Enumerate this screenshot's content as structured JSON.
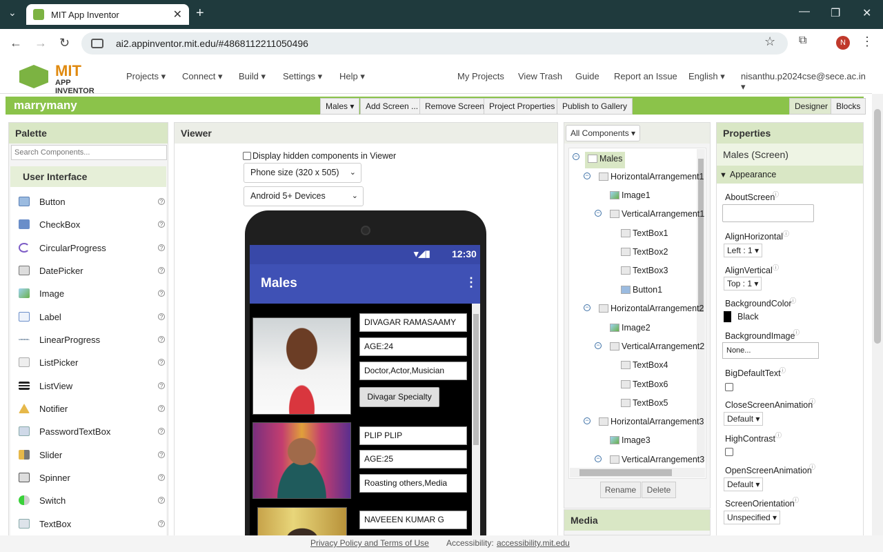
{
  "browser": {
    "tab_title": "MIT App Inventor",
    "url": "ai2.appinventor.mit.edu/#4868112211050496",
    "profile_initial": "N",
    "new_tab": "+",
    "close_tab": "✕",
    "minimize": "—",
    "restore": "❐",
    "close": "✕",
    "back": "←",
    "forward": "→",
    "reload": "↻",
    "star": "☆",
    "menu": "⋮"
  },
  "header": {
    "logo_line1": "MIT",
    "logo_line2": "APP INVENTOR",
    "menus": [
      "Projects ▾",
      "Connect ▾",
      "Build ▾",
      "Settings ▾",
      "Help ▾"
    ],
    "links": [
      "My Projects",
      "View Trash",
      "Guide",
      "Report an Issue",
      "English ▾",
      "nisanthu.p2024cse@sece.ac.in ▾"
    ]
  },
  "toolbar": {
    "project_name": "marrymany",
    "screen_select": "Males ▾",
    "add_screen": "Add Screen ...",
    "remove_screen": "Remove Screen",
    "project_properties": "Project Properties",
    "publish": "Publish to Gallery",
    "designer": "Designer",
    "blocks": "Blocks"
  },
  "palette": {
    "title": "Palette",
    "search_placeholder": "Search Components...",
    "category": "User Interface",
    "items": [
      "Button",
      "CheckBox",
      "CircularProgress",
      "DatePicker",
      "Image",
      "Label",
      "LinearProgress",
      "ListPicker",
      "ListView",
      "Notifier",
      "PasswordTextBox",
      "Slider",
      "Spinner",
      "Switch",
      "TextBox"
    ]
  },
  "viewer": {
    "title": "Viewer",
    "hidden_label": "Display hidden components in Viewer",
    "size_select": "Phone size (320 x 505)",
    "device_select": "Android 5+ Devices",
    "status_time": "12:30",
    "screen_title": "Males",
    "profiles": [
      {
        "name": "DIVAGAR RAMASAAMY",
        "age": "AGE:24",
        "desc": "Doctor,Actor,Musician",
        "button": "Divagar Specialty"
      },
      {
        "name": "PLIP PLIP",
        "age": "AGE:25",
        "desc": "Roasting others,Media"
      },
      {
        "name": "NAVEEEN KUMAR G"
      }
    ]
  },
  "components": {
    "title": "All Components ▾",
    "tree": [
      "Males",
      "HorizontalArrangement1",
      "Image1",
      "VerticalArrangement1",
      "TextBox1",
      "TextBox2",
      "TextBox3",
      "Button1",
      "HorizontalArrangement2",
      "Image2",
      "VerticalArrangement2",
      "TextBox4",
      "TextBox6",
      "TextBox5",
      "HorizontalArrangement3",
      "Image3",
      "VerticalArrangement3"
    ],
    "rename": "Rename",
    "delete": "Delete",
    "media_title": "Media"
  },
  "properties": {
    "title": "Properties",
    "subject": "Males (Screen)",
    "section": "Appearance",
    "about_screen": "AboutScreen",
    "align_h": "AlignHorizontal",
    "align_h_val": "Left : 1 ▾",
    "align_v": "AlignVertical",
    "align_v_val": "Top : 1 ▾",
    "bg_color": "BackgroundColor",
    "bg_color_val": "Black",
    "bg_image": "BackgroundImage",
    "bg_image_val": "None...",
    "big_text": "BigDefaultText",
    "close_anim": "CloseScreenAnimation",
    "close_anim_val": "Default ▾",
    "high_contrast": "HighContrast",
    "open_anim": "OpenScreenAnimation",
    "open_anim_val": "Default ▾",
    "orientation": "ScreenOrientation",
    "orientation_val": "Unspecified ▾"
  },
  "footer": {
    "privacy": "Privacy Policy and Terms of Use",
    "access_label": "Accessibility:",
    "access_link": "accessibility.mit.edu"
  },
  "colors": {
    "accent_green": "#8bc34a",
    "app_bar": "#3f51b5",
    "chrome": "#1f3a3d"
  }
}
